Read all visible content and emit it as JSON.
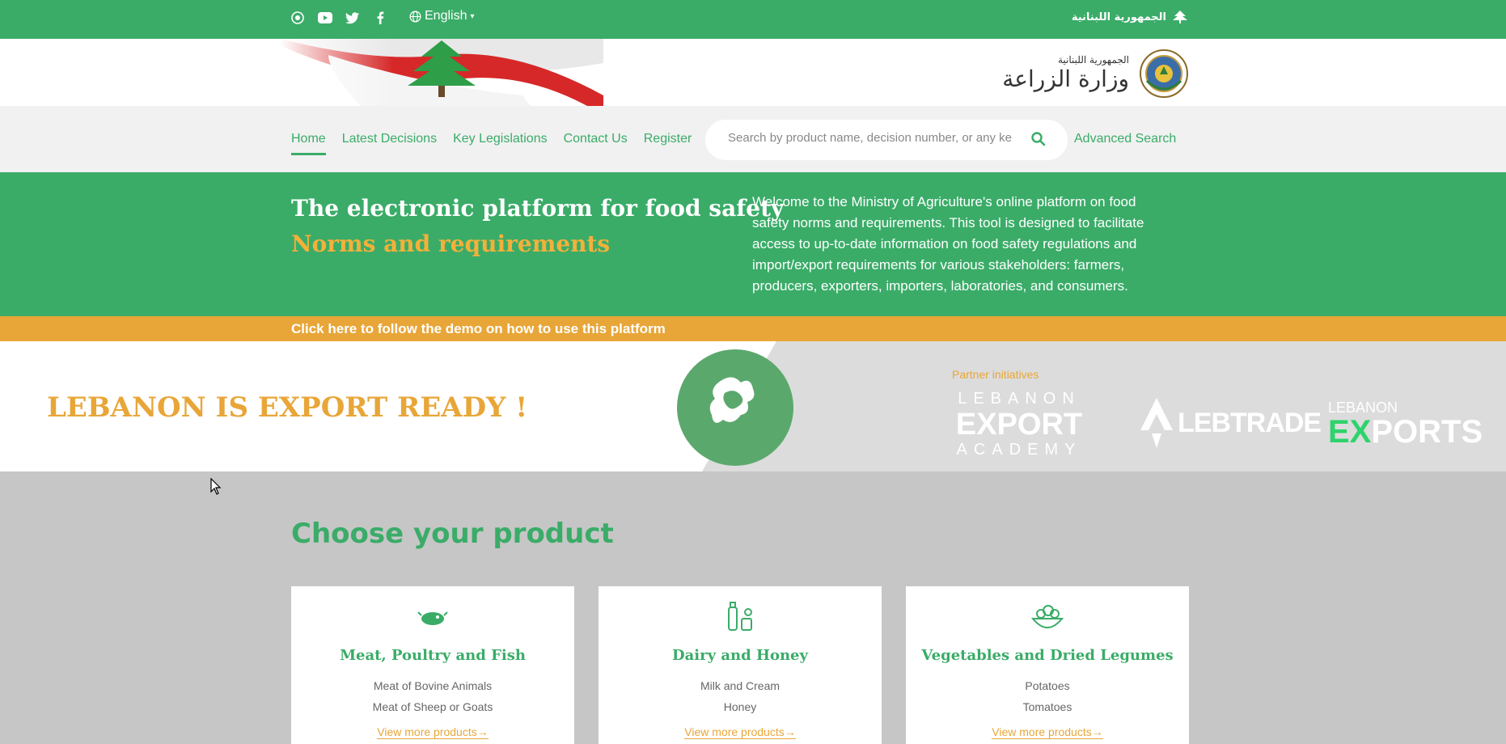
{
  "topbar": {
    "language": "English",
    "republic": "الجمهورية اللبنانية",
    "social_icons": [
      "ministry-logo-icon",
      "youtube-icon",
      "twitter-icon",
      "facebook-icon"
    ]
  },
  "header": {
    "ministry_small": "الجمهورية اللبنانية",
    "ministry_name": "وزارة الزراعة"
  },
  "nav": {
    "items": [
      "Home",
      "Latest Decisions",
      "Key Legislations",
      "Contact Us",
      "Register"
    ],
    "active": "Home",
    "search_placeholder": "Search by product name, decision number, or any ke",
    "advanced_search": "Advanced Search"
  },
  "hero": {
    "title": "The electronic platform for food safety",
    "subtitle": "Norms and requirements",
    "description": "Welcome to the Ministry of Agriculture's online platform on food safety norms and requirements. This tool is designed to facilitate access to up-to-date information on food safety regulations and import/export requirements for various stakeholders: farmers, producers, exporters, importers, laboratories, and consumers."
  },
  "demo": {
    "label": "Click here to follow the demo on how to use this platform"
  },
  "export_band": {
    "headline": "LEBANON IS EXPORT READY !",
    "partner_label": "Partner initiatives",
    "academy": {
      "line1": "LEBANON",
      "line2": "EXPORT",
      "line3": "ACADEMY"
    },
    "lebtrade": "LEBTRADE",
    "lebexports": {
      "line1": "LEBANON",
      "ex": "EX",
      "rest": "PORTS"
    }
  },
  "products": {
    "heading": "Choose your product",
    "cards": [
      {
        "title": "Meat, Poultry and Fish",
        "items": [
          "Meat of Bovine Animals",
          "Meat of Sheep or Goats"
        ],
        "more": "View more products→",
        "icon": "meat-fish-icon"
      },
      {
        "title": "Dairy and Honey",
        "items": [
          "Milk and Cream",
          "Honey"
        ],
        "more": "View more products→",
        "icon": "dairy-honey-icon"
      },
      {
        "title": "Vegetables and Dried Legumes",
        "items": [
          "Potatoes",
          "Tomatoes"
        ],
        "more": "View more products→",
        "icon": "vegetables-icon"
      }
    ]
  },
  "colors": {
    "green": "#3aac68",
    "orange": "#e8a638",
    "gold": "#f4b03a",
    "nav_bg": "#f1f1f1",
    "grey_bg": "#c6c6c6"
  }
}
